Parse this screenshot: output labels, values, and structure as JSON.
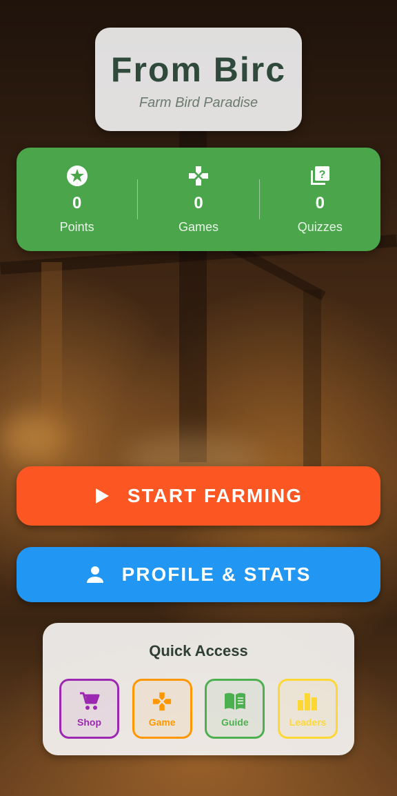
{
  "header": {
    "title": "From Birc",
    "subtitle": "Farm Bird Paradise"
  },
  "stats": [
    {
      "icon": "star-circle-icon",
      "value": "0",
      "label": "Points"
    },
    {
      "icon": "gamepad-icon",
      "value": "0",
      "label": "Games"
    },
    {
      "icon": "quiz-icon",
      "value": "0",
      "label": "Quizzes"
    }
  ],
  "actions": {
    "start_label": "START FARMING",
    "start_icon": "play-icon",
    "profile_label": "PROFILE & STATS",
    "profile_icon": "person-icon"
  },
  "quick_access": {
    "title": "Quick Access",
    "items": [
      {
        "label": "Shop",
        "icon": "cart-icon",
        "color": "#9c27b0"
      },
      {
        "label": "Game",
        "icon": "gamepad-icon",
        "color": "#ff9800"
      },
      {
        "label": "Guide",
        "icon": "book-icon",
        "color": "#4caf50"
      },
      {
        "label": "Leaders",
        "icon": "leaderboard-icon",
        "color": "#fdd835"
      }
    ]
  },
  "colors": {
    "stats_bg": "#4aa54b",
    "start_bg": "#fc5722",
    "profile_bg": "#2196f3",
    "title_text": "#2f4a3a"
  }
}
